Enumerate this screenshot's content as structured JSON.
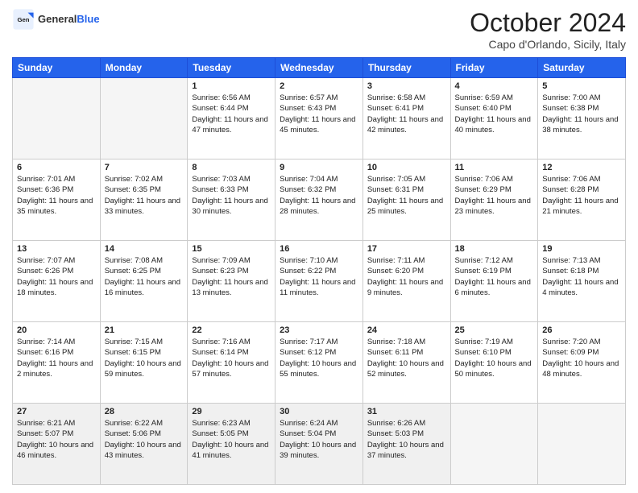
{
  "header": {
    "logo_general": "General",
    "logo_blue": "Blue",
    "month_title": "October 2024",
    "location": "Capo d'Orlando, Sicily, Italy"
  },
  "days_of_week": [
    "Sunday",
    "Monday",
    "Tuesday",
    "Wednesday",
    "Thursday",
    "Friday",
    "Saturday"
  ],
  "weeks": [
    [
      {
        "day": "",
        "info": ""
      },
      {
        "day": "",
        "info": ""
      },
      {
        "day": "1",
        "sunrise": "Sunrise: 6:56 AM",
        "sunset": "Sunset: 6:44 PM",
        "daylight": "Daylight: 11 hours and 47 minutes."
      },
      {
        "day": "2",
        "sunrise": "Sunrise: 6:57 AM",
        "sunset": "Sunset: 6:43 PM",
        "daylight": "Daylight: 11 hours and 45 minutes."
      },
      {
        "day": "3",
        "sunrise": "Sunrise: 6:58 AM",
        "sunset": "Sunset: 6:41 PM",
        "daylight": "Daylight: 11 hours and 42 minutes."
      },
      {
        "day": "4",
        "sunrise": "Sunrise: 6:59 AM",
        "sunset": "Sunset: 6:40 PM",
        "daylight": "Daylight: 11 hours and 40 minutes."
      },
      {
        "day": "5",
        "sunrise": "Sunrise: 7:00 AM",
        "sunset": "Sunset: 6:38 PM",
        "daylight": "Daylight: 11 hours and 38 minutes."
      }
    ],
    [
      {
        "day": "6",
        "sunrise": "Sunrise: 7:01 AM",
        "sunset": "Sunset: 6:36 PM",
        "daylight": "Daylight: 11 hours and 35 minutes."
      },
      {
        "day": "7",
        "sunrise": "Sunrise: 7:02 AM",
        "sunset": "Sunset: 6:35 PM",
        "daylight": "Daylight: 11 hours and 33 minutes."
      },
      {
        "day": "8",
        "sunrise": "Sunrise: 7:03 AM",
        "sunset": "Sunset: 6:33 PM",
        "daylight": "Daylight: 11 hours and 30 minutes."
      },
      {
        "day": "9",
        "sunrise": "Sunrise: 7:04 AM",
        "sunset": "Sunset: 6:32 PM",
        "daylight": "Daylight: 11 hours and 28 minutes."
      },
      {
        "day": "10",
        "sunrise": "Sunrise: 7:05 AM",
        "sunset": "Sunset: 6:31 PM",
        "daylight": "Daylight: 11 hours and 25 minutes."
      },
      {
        "day": "11",
        "sunrise": "Sunrise: 7:06 AM",
        "sunset": "Sunset: 6:29 PM",
        "daylight": "Daylight: 11 hours and 23 minutes."
      },
      {
        "day": "12",
        "sunrise": "Sunrise: 7:06 AM",
        "sunset": "Sunset: 6:28 PM",
        "daylight": "Daylight: 11 hours and 21 minutes."
      }
    ],
    [
      {
        "day": "13",
        "sunrise": "Sunrise: 7:07 AM",
        "sunset": "Sunset: 6:26 PM",
        "daylight": "Daylight: 11 hours and 18 minutes."
      },
      {
        "day": "14",
        "sunrise": "Sunrise: 7:08 AM",
        "sunset": "Sunset: 6:25 PM",
        "daylight": "Daylight: 11 hours and 16 minutes."
      },
      {
        "day": "15",
        "sunrise": "Sunrise: 7:09 AM",
        "sunset": "Sunset: 6:23 PM",
        "daylight": "Daylight: 11 hours and 13 minutes."
      },
      {
        "day": "16",
        "sunrise": "Sunrise: 7:10 AM",
        "sunset": "Sunset: 6:22 PM",
        "daylight": "Daylight: 11 hours and 11 minutes."
      },
      {
        "day": "17",
        "sunrise": "Sunrise: 7:11 AM",
        "sunset": "Sunset: 6:20 PM",
        "daylight": "Daylight: 11 hours and 9 minutes."
      },
      {
        "day": "18",
        "sunrise": "Sunrise: 7:12 AM",
        "sunset": "Sunset: 6:19 PM",
        "daylight": "Daylight: 11 hours and 6 minutes."
      },
      {
        "day": "19",
        "sunrise": "Sunrise: 7:13 AM",
        "sunset": "Sunset: 6:18 PM",
        "daylight": "Daylight: 11 hours and 4 minutes."
      }
    ],
    [
      {
        "day": "20",
        "sunrise": "Sunrise: 7:14 AM",
        "sunset": "Sunset: 6:16 PM",
        "daylight": "Daylight: 11 hours and 2 minutes."
      },
      {
        "day": "21",
        "sunrise": "Sunrise: 7:15 AM",
        "sunset": "Sunset: 6:15 PM",
        "daylight": "Daylight: 10 hours and 59 minutes."
      },
      {
        "day": "22",
        "sunrise": "Sunrise: 7:16 AM",
        "sunset": "Sunset: 6:14 PM",
        "daylight": "Daylight: 10 hours and 57 minutes."
      },
      {
        "day": "23",
        "sunrise": "Sunrise: 7:17 AM",
        "sunset": "Sunset: 6:12 PM",
        "daylight": "Daylight: 10 hours and 55 minutes."
      },
      {
        "day": "24",
        "sunrise": "Sunrise: 7:18 AM",
        "sunset": "Sunset: 6:11 PM",
        "daylight": "Daylight: 10 hours and 52 minutes."
      },
      {
        "day": "25",
        "sunrise": "Sunrise: 7:19 AM",
        "sunset": "Sunset: 6:10 PM",
        "daylight": "Daylight: 10 hours and 50 minutes."
      },
      {
        "day": "26",
        "sunrise": "Sunrise: 7:20 AM",
        "sunset": "Sunset: 6:09 PM",
        "daylight": "Daylight: 10 hours and 48 minutes."
      }
    ],
    [
      {
        "day": "27",
        "sunrise": "Sunrise: 6:21 AM",
        "sunset": "Sunset: 5:07 PM",
        "daylight": "Daylight: 10 hours and 46 minutes."
      },
      {
        "day": "28",
        "sunrise": "Sunrise: 6:22 AM",
        "sunset": "Sunset: 5:06 PM",
        "daylight": "Daylight: 10 hours and 43 minutes."
      },
      {
        "day": "29",
        "sunrise": "Sunrise: 6:23 AM",
        "sunset": "Sunset: 5:05 PM",
        "daylight": "Daylight: 10 hours and 41 minutes."
      },
      {
        "day": "30",
        "sunrise": "Sunrise: 6:24 AM",
        "sunset": "Sunset: 5:04 PM",
        "daylight": "Daylight: 10 hours and 39 minutes."
      },
      {
        "day": "31",
        "sunrise": "Sunrise: 6:26 AM",
        "sunset": "Sunset: 5:03 PM",
        "daylight": "Daylight: 10 hours and 37 minutes."
      },
      {
        "day": "",
        "info": ""
      },
      {
        "day": "",
        "info": ""
      }
    ]
  ]
}
